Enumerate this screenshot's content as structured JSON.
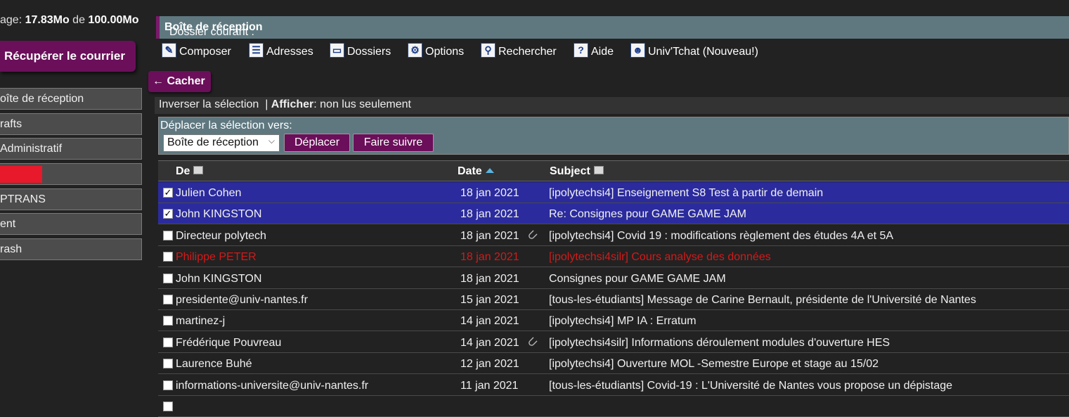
{
  "quota": {
    "prefix": "age: ",
    "used": "17.83Mo",
    "of": " de ",
    "total": "100.00Mo"
  },
  "fetch_button": "Récupérer le courrier",
  "folders": [
    {
      "label": "oîte de réception"
    },
    {
      "label": "rafts"
    },
    {
      "label": " Administratif"
    },
    {
      "label": ""
    },
    {
      "label": "PTRANS"
    },
    {
      "label": "ent"
    },
    {
      "label": "rash"
    }
  ],
  "current_folder": {
    "prefix": "Dossier courant : ",
    "name": "Boîte de réception"
  },
  "toolbar": {
    "compose": "Composer",
    "addresses": "Adresses",
    "folders": "Dossiers",
    "options": "Options",
    "search": "Rechercher",
    "help": "Aide",
    "chat": "Univ'Tchat (Nouveau!)"
  },
  "hide_button": "← Cacher",
  "selection_bar": {
    "invert": "Inverser la sélection",
    "separator": "  | ",
    "show_label": "Afficher",
    "show_value": ": non lus seulement"
  },
  "move": {
    "label": "Déplacer la sélection vers:",
    "selected_folder": "Boîte de réception",
    "move_button": "Déplacer",
    "forward_button": "Faire suivre"
  },
  "columns": {
    "from": "De",
    "date": "Date",
    "subject": "Subject"
  },
  "messages": [
    {
      "from": "Julien Cohen",
      "date": "18 jan 2021",
      "subject": "[ipolytechsi4] Enseignement S8 Test à partir de demain",
      "checked": true,
      "attachment": false
    },
    {
      "from": "John KINGSTON",
      "date": "18 jan 2021",
      "subject": "Re: Consignes pour GAME GAME JAM",
      "checked": true,
      "attachment": false
    },
    {
      "from": "Directeur polytech",
      "date": "18 jan 2021",
      "subject": "[ipolytechsi4] Covid 19 : modifications règlement des études 4A et 5A",
      "checked": false,
      "attachment": true
    },
    {
      "from": "Philippe PETER",
      "date": "18 jan 2021",
      "subject": "[ipolytechsi4silr] Cours analyse des données",
      "checked": false,
      "attachment": false,
      "flagged": true
    },
    {
      "from": "John KINGSTON",
      "date": "18 jan 2021",
      "subject": "Consignes pour GAME GAME JAM",
      "checked": false,
      "attachment": false
    },
    {
      "from": "presidente@univ-nantes.fr",
      "date": "15 jan 2021",
      "subject": "[tous-les-étudiants] Message de Carine Bernault, présidente de l'Université de Nantes",
      "checked": false,
      "attachment": false
    },
    {
      "from": "martinez-j",
      "date": "14 jan 2021",
      "subject": "[ipolytechsi4] MP IA : Erratum",
      "checked": false,
      "attachment": false
    },
    {
      "from": "Frédérique Pouvreau",
      "date": "14 jan 2021",
      "subject": "[ipolytechsi4silr] Informations déroulement modules d'ouverture HES",
      "checked": false,
      "attachment": true
    },
    {
      "from": "Laurence Buhé",
      "date": "12 jan 2021",
      "subject": "[ipolytechsi4] Ouverture MOL -Semestre Europe et stage au 15/02",
      "checked": false,
      "attachment": false
    },
    {
      "from": "informations-universite@univ-nantes.fr",
      "date": "11 jan 2021",
      "subject": "[tous-les-étudiants] Covid-19 : L'Université de Nantes vous propose un dépistage",
      "checked": false,
      "attachment": false
    },
    {
      "from": "",
      "date": "",
      "subject": "",
      "checked": false,
      "attachment": false
    }
  ]
}
